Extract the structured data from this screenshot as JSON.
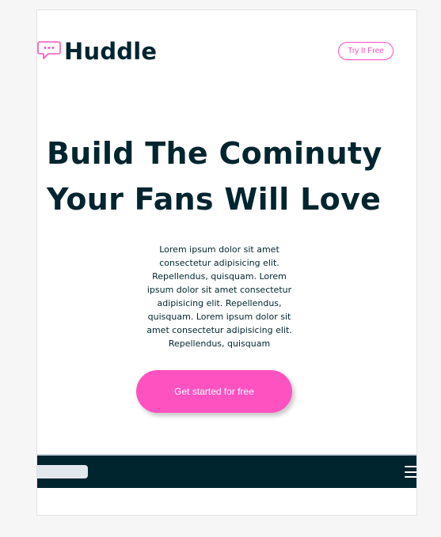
{
  "brand": {
    "name": "Huddle",
    "icon": "chat-bubble-icon",
    "icon_color": "#ff52c1",
    "text_color": "#00252e"
  },
  "header": {
    "cta_label": "Try It Free"
  },
  "hero": {
    "title_line1": "Build The Cominuty",
    "title_line2": "Your Fans Will Love",
    "body": "Lorem ipsum dolor sit amet consectetur adipisicing elit. Repellendus, quisquam. Lorem ipsum dolor sit amet consectetur adipisicing elit. Repellendus, quisquam. Lorem ipsum dolor sit amet consectetur adipisicing elit. Repellendus, quisquam",
    "cta_label": "Get started for free",
    "accent_color": "#ff52c1"
  },
  "footer": {
    "menu_icon": "hamburger-menu-icon",
    "background_color": "#00252e"
  }
}
